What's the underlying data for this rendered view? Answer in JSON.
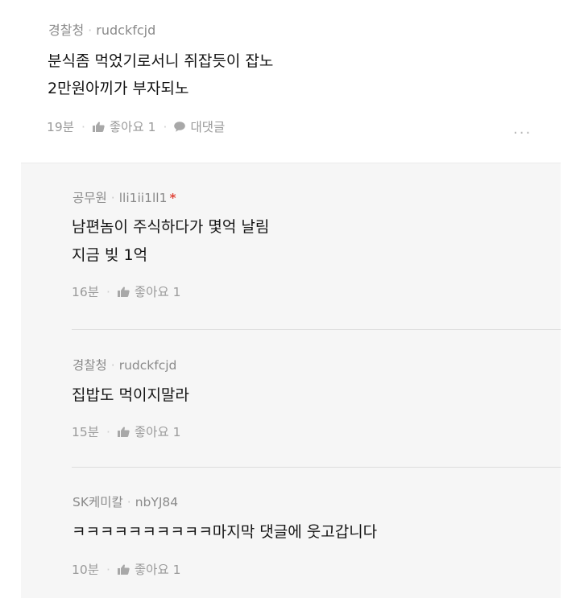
{
  "main_comment": {
    "author": "경찰청",
    "user_id": "rudckfcjd",
    "lines": [
      "분식좀 먹었기로서니 쥐잡듯이 잡노",
      "2만원아끼가 부자되노"
    ],
    "time": "19분",
    "like_label": "좋아요 1",
    "reply_label": "대댓글",
    "more_label": "..."
  },
  "replies": [
    {
      "author": "공무원",
      "user_id": "lli1ii1ll1",
      "badge": "*",
      "lines": [
        "남편놈이 주식하다가 몇억 날림",
        "지금 빚 1억"
      ],
      "time": "16분",
      "like_label": "좋아요 1"
    },
    {
      "author": "경찰청",
      "user_id": "rudckfcjd",
      "lines": [
        "집밥도 먹이지말라"
      ],
      "time": "15분",
      "like_label": "좋아요 1"
    },
    {
      "author": "SK케미칼",
      "user_id": "nbYJ84",
      "lines": [
        "ㅋㅋㅋㅋㅋㅋㅋㅋㅋㅋ마지막 댓글에 웃고갑니다"
      ],
      "time": "10분",
      "like_label": "좋아요 1"
    }
  ],
  "colors": {
    "reply_background": "#f6f6f6",
    "badge_red": "#e0473c",
    "meta_gray": "#8a8a8a"
  },
  "icons": {
    "like": "thumbs-up-icon",
    "reply": "speech-bubble-icon",
    "more": "more-dots-icon"
  }
}
